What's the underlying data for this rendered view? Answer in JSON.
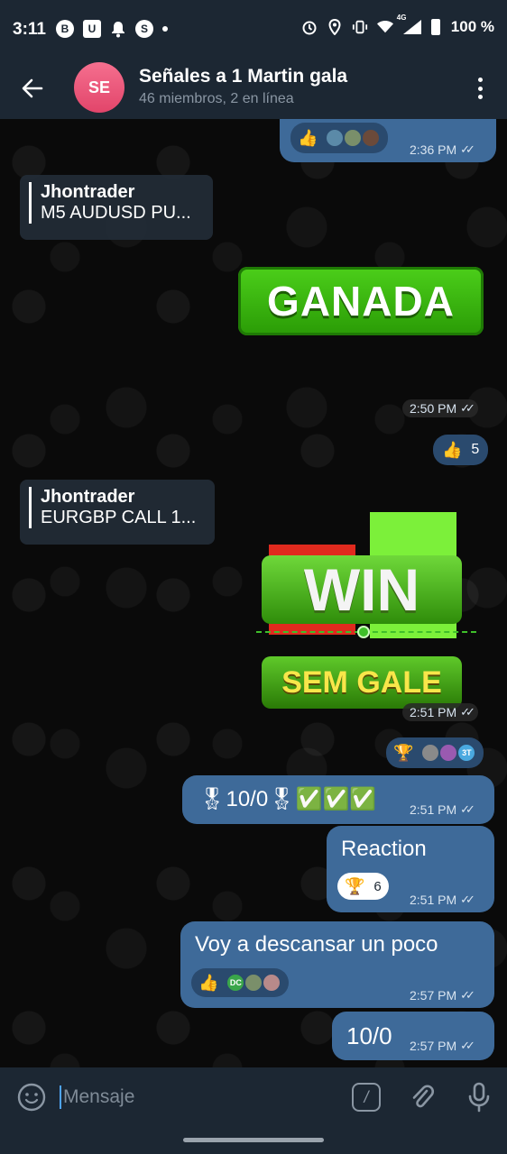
{
  "status_bar": {
    "time": "3:11",
    "left_icons": [
      "b-circle-icon",
      "u-box-icon",
      "bell-icon",
      "s-circle-icon"
    ],
    "battery": "100 %",
    "network": "4G"
  },
  "header": {
    "avatar_initials": "SE",
    "title": "Señales a 1 Martin gala",
    "subtitle": "46 miembros, 2 en línea"
  },
  "messages": {
    "m1": {
      "reaction": "👍",
      "time": "2:36 PM"
    },
    "m2": {
      "reply_name": "Jhontrader",
      "reply_text": "M5 AUDUSD PU..."
    },
    "m3": {
      "sticker_text": "GANADA",
      "time": "2:50 PM",
      "reaction": "👍",
      "reaction_count": "5"
    },
    "m4": {
      "reply_name": "Jhontrader",
      "reply_text": "EURGBP CALL 1..."
    },
    "m5": {
      "sticker_text": "WIN",
      "sticker_text2": "SEM GALE",
      "time": "2:51 PM",
      "reaction": "🏆",
      "avatar_label": "3T"
    },
    "m6": {
      "text": "🎖10/0🎖✅✅✅",
      "time": "2:51 PM"
    },
    "m7": {
      "text": "Reaction",
      "reaction": "🏆",
      "reaction_count": "6",
      "time": "2:51 PM"
    },
    "m8": {
      "text": "Voy a descansar un poco",
      "reaction": "👍",
      "avatar_label": "DC",
      "time": "2:57 PM"
    },
    "m9": {
      "text": "10/0",
      "time": "2:57 PM"
    }
  },
  "input": {
    "placeholder": "Mensaje",
    "cmd_label": "/"
  },
  "colors": {
    "header_bg": "#1c2733",
    "outgoing_bubble": "#3e6a99",
    "accent_green": "#2a9b06",
    "avatar_pink": "#e2456a"
  }
}
